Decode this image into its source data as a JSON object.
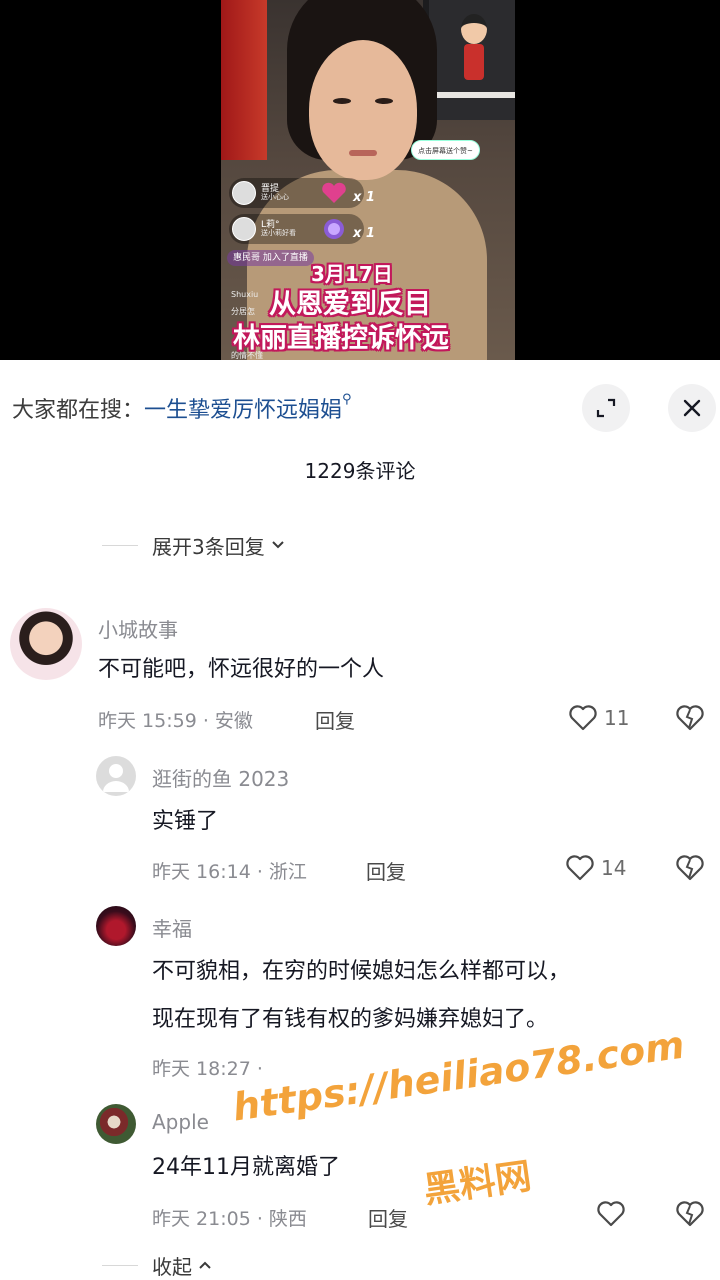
{
  "video": {
    "gift_rows": [
      {
        "name": "晋提",
        "sub": "送小心心",
        "count": "x 1"
      },
      {
        "name": "L莉°",
        "sub": "送小莉好看",
        "count": "x 1"
      }
    ],
    "like_bubble": "点击屏幕送个赞~",
    "join_text": "惠民哥 加入了直播",
    "overlay_name": "Shuxiu",
    "overlay_sub": "分居怎",
    "overlay_bottom": "的情不懂",
    "caption_date": "3月17日",
    "caption_line1": "从恩爱到反目",
    "caption_line2": "林丽直播控诉怀远"
  },
  "search": {
    "prefix": "大家都在搜：",
    "query": "一生挚爱厉怀远娟娟",
    "icon": "search-icon"
  },
  "comment_count": "1229条评论",
  "expand_replies": "展开3条回复",
  "collapse_replies": "收起",
  "comments": [
    {
      "author": "小城故事",
      "text": "不可能吧，怀远很好的一个人",
      "meta": "昨天 15:59 · 安徽",
      "reply": "回复",
      "likes": "11"
    },
    {
      "author": "逛街的鱼 2023",
      "text": "实锤了",
      "meta": "昨天 16:14 · 浙江",
      "reply": "回复",
      "likes": "14"
    },
    {
      "author": "幸福",
      "text_line1": "不可貌相，在穷的时候媳妇怎么样都可以，",
      "text_line2": "现在现有了有钱有权的爹妈嫌弃媳妇了。",
      "meta": "昨天 18:27 ·"
    },
    {
      "author": "Apple",
      "text": "24年11月就离婚了",
      "meta": "昨天 21:05 · 陕西",
      "reply": "回复"
    }
  ],
  "watermark": {
    "url": "https://heiliao78.com",
    "name": "黑料网"
  },
  "colors": {
    "search_link": "#1d4f91",
    "meta_gray": "#8a8b91",
    "watermark": "#f29c2b"
  }
}
